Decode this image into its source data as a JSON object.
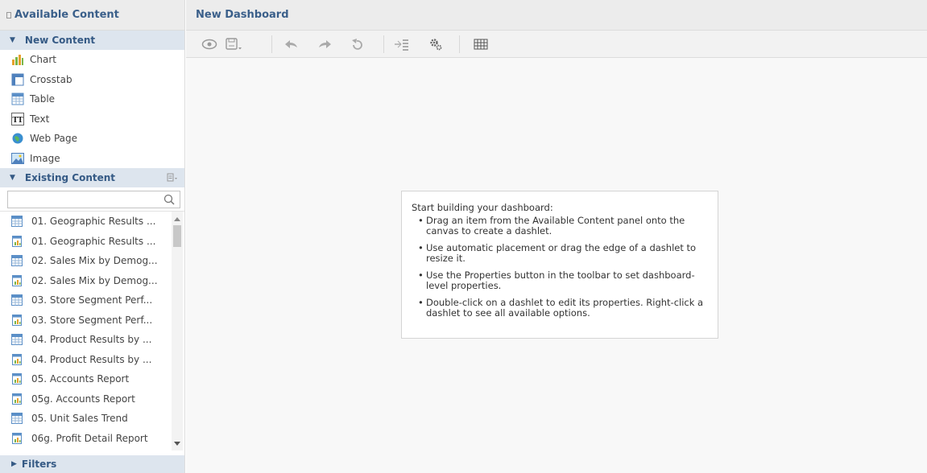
{
  "left_panel": {
    "title": "Available Content",
    "new_content": {
      "header": "New Content",
      "items": [
        {
          "label": "Chart",
          "icon": "chart-icon"
        },
        {
          "label": "Crosstab",
          "icon": "crosstab-icon"
        },
        {
          "label": "Table",
          "icon": "table-icon"
        },
        {
          "label": "Text",
          "icon": "text-icon"
        },
        {
          "label": "Web Page",
          "icon": "web-page-icon"
        },
        {
          "label": "Image",
          "icon": "image-icon"
        }
      ]
    },
    "existing_content": {
      "header": "Existing Content",
      "search": {
        "value": "",
        "placeholder": ""
      },
      "items": [
        {
          "label": "01. Geographic Results ...",
          "icon": "table-icon"
        },
        {
          "label": "01. Geographic Results ...",
          "icon": "report-icon"
        },
        {
          "label": "02. Sales Mix by Demog...",
          "icon": "table-icon"
        },
        {
          "label": "02. Sales Mix by Demog...",
          "icon": "report-icon"
        },
        {
          "label": "03. Store Segment Perf...",
          "icon": "table-icon"
        },
        {
          "label": "03. Store Segment Perf...",
          "icon": "report-icon"
        },
        {
          "label": "04. Product Results by ...",
          "icon": "table-icon"
        },
        {
          "label": "04. Product Results by ...",
          "icon": "report-icon"
        },
        {
          "label": "05. Accounts Report",
          "icon": "report-icon"
        },
        {
          "label": "05g. Accounts Report",
          "icon": "report-icon"
        },
        {
          "label": "05. Unit Sales Trend",
          "icon": "table-icon"
        },
        {
          "label": "06g. Profit Detail Report",
          "icon": "report-icon"
        }
      ]
    },
    "filters": {
      "header": "Filters"
    }
  },
  "main": {
    "title": "New Dashboard",
    "toolbar": [
      "preview-icon",
      "save-icon",
      "undo-icon",
      "redo-icon",
      "undo-all-icon",
      "layout-icon",
      "properties-icon",
      "grid-icon"
    ],
    "hint": {
      "title": "Start building your dashboard:",
      "items": [
        "Drag an item from the Available Content panel onto the canvas to create a dashlet.",
        "Use automatic placement or drag the edge of a dashlet to resize it.",
        "Use the Properties button in the toolbar to set dashboard-level properties.",
        "Double-click on a dashlet to edit its properties. Right-click a dashlet to see all available options."
      ]
    }
  }
}
